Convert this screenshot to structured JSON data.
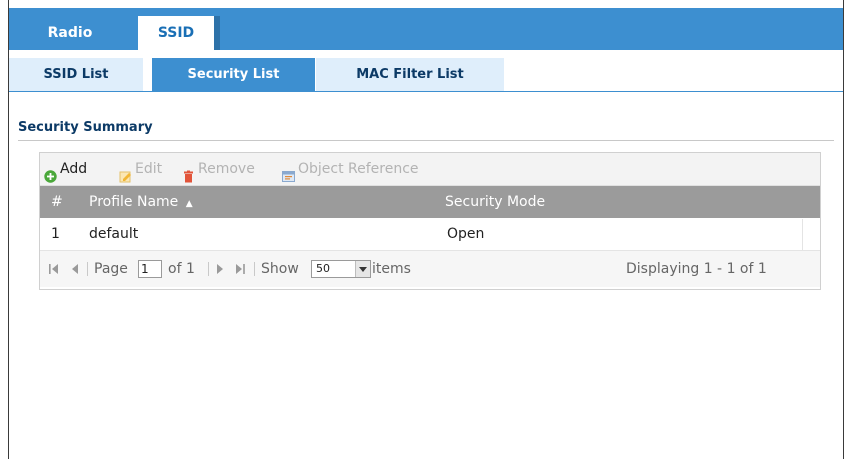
{
  "tabs_primary": [
    {
      "label": "Radio"
    },
    {
      "label": "SSID"
    }
  ],
  "tabs_secondary": [
    {
      "label": "SSID List"
    },
    {
      "label": "Security List"
    },
    {
      "label": "MAC Filter List"
    }
  ],
  "section": {
    "title": "Security Summary"
  },
  "toolbar": {
    "add_label": "Add",
    "edit_label": "Edit",
    "remove_label": "Remove",
    "object_reference_label": "Object Reference"
  },
  "table": {
    "headers": {
      "index": "#",
      "profile_name": "Profile Name",
      "security_mode": "Security Mode"
    },
    "sort_indicator": "▲",
    "rows": [
      {
        "index": "1",
        "profile_name": "default",
        "security_mode": "Open"
      }
    ]
  },
  "pager": {
    "page_label": "Page",
    "page_value": "1",
    "of_label": "of 1",
    "show_label": "Show",
    "show_value": "50",
    "items_label": "items",
    "displaying": "Displaying 1 - 1 of 1"
  },
  "colors": {
    "accent_blue": "#3d8fd0",
    "tab_dark_text": "#0c3a66",
    "header_gray": "#9b9b9b",
    "add_green": "#4aa83a",
    "edit_orange": "#f2b736",
    "remove_red": "#e2543a"
  }
}
